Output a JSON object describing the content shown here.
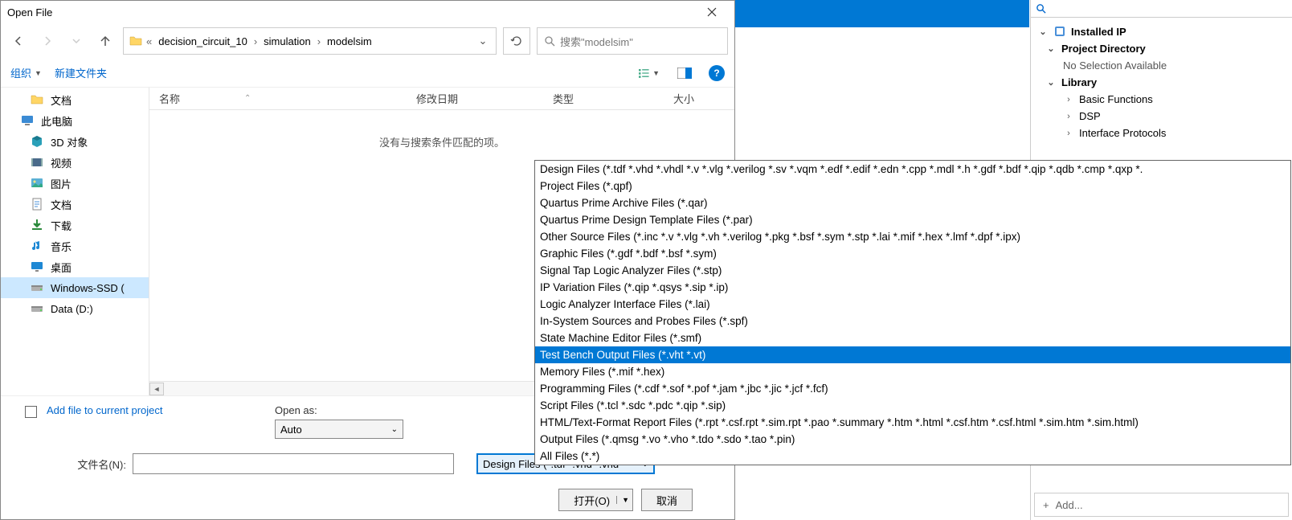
{
  "dialog": {
    "title": "Open File",
    "breadcrumb": [
      "decision_circuit_10",
      "simulation",
      "modelsim"
    ],
    "search_placeholder": "搜索\"modelsim\"",
    "organize": "组织",
    "new_folder": "新建文件夹",
    "columns": {
      "name": "名称",
      "date": "修改日期",
      "type": "类型",
      "size": "大小"
    },
    "empty_msg": "没有与搜索条件匹配的项。",
    "sidebar": [
      {
        "label": "文档",
        "icon": "docfolder",
        "lvl": 2
      },
      {
        "label": "此电脑",
        "icon": "pc",
        "lvl": 1
      },
      {
        "label": "3D 对象",
        "icon": "3d",
        "lvl": 2
      },
      {
        "label": "视频",
        "icon": "video",
        "lvl": 2
      },
      {
        "label": "图片",
        "icon": "pic",
        "lvl": 2
      },
      {
        "label": "文档",
        "icon": "doc",
        "lvl": 2
      },
      {
        "label": "下载",
        "icon": "download",
        "lvl": 2
      },
      {
        "label": "音乐",
        "icon": "music",
        "lvl": 2
      },
      {
        "label": "桌面",
        "icon": "desktop",
        "lvl": 2
      },
      {
        "label": "Windows-SSD (",
        "icon": "drive",
        "lvl": 2,
        "selected": true
      },
      {
        "label": "Data (D:)",
        "icon": "drive",
        "lvl": 2
      }
    ],
    "add_to_project": "Add file to current project",
    "open_as_label": "Open as:",
    "open_as_value": "Auto",
    "filename_label": "文件名(N):",
    "filetype_value": "Design Files (*.tdf *.vhd *.vhd",
    "open_btn": "打开(O)",
    "cancel_btn": "取消"
  },
  "filetypes": [
    "Design Files (*.tdf *.vhd *.vhdl *.v *.vlg *.verilog *.sv *.vqm *.edf *.edif *.edn *.cpp *.mdl *.h *.gdf *.bdf *.qip *.qdb *.cmp *.qxp *.",
    "Project Files (*.qpf)",
    "Quartus Prime Archive Files (*.qar)",
    "Quartus Prime Design Template Files (*.par)",
    "Other Source Files (*.inc *.v *.vlg *.vh *.verilog *.pkg *.bsf *.sym *.stp *.lai *.mif *.hex *.lmf *.dpf *.ipx)",
    "Graphic Files (*.gdf *.bdf *.bsf *.sym)",
    "Signal Tap Logic Analyzer Files (*.stp)",
    "IP Variation Files (*.qip *.qsys *.sip *.ip)",
    "Logic Analyzer Interface Files (*.lai)",
    "In-System Sources and Probes Files (*.spf)",
    "State Machine Editor Files (*.smf)",
    "Test Bench Output Files (*.vht *.vt)",
    "Memory Files (*.mif *.hex)",
    "Programming Files (*.cdf *.sof *.pof *.jam *.jbc *.jic *.jcf *.fcf)",
    "Script Files (*.tcl *.sdc *.pdc *.qip *.sip)",
    "HTML/Text-Format Report Files (*.rpt *.csf.rpt *.sim.rpt *.pao *.summary *.htm *.html *.csf.htm *.csf.html *.sim.htm *.sim.html)",
    "Output Files (*.qmsg *.vo *.vho *.tdo *.sdo *.tao *.pin)",
    "All Files (*.*)"
  ],
  "filetypes_selected": 11,
  "rightpanel": {
    "installed_ip": "Installed IP",
    "project_dir": "Project Directory",
    "no_selection": "No Selection Available",
    "library": "Library",
    "items": [
      "Basic Functions",
      "DSP",
      "Interface Protocols"
    ],
    "add": "Add..."
  }
}
